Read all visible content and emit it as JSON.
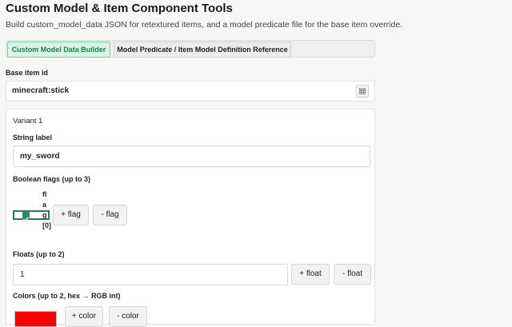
{
  "page": {
    "title": "Custom Model & Item Component Tools",
    "subtitle": "Build custom_model_data JSON for retextured items, and a model predicate file for the base item override."
  },
  "tabs": [
    {
      "label": "Custom Model Data Builder",
      "active": true
    },
    {
      "label": "Model Predicate / Item Model Definition Reference",
      "active": false
    }
  ],
  "base_item": {
    "label": "Base item id",
    "value": "minecraft:stick",
    "picker_icon": "calendar-icon"
  },
  "variant": {
    "title": "Variant 1",
    "string_label": {
      "label": "String label",
      "value": "my_sword"
    },
    "flags": {
      "label": "Boolean flags (up to 3)",
      "items": [
        {
          "name": "flag[0]",
          "checked": true
        }
      ],
      "add_label": "+ flag",
      "remove_label": "- flag"
    },
    "floats": {
      "label": "Floats (up to 2)",
      "values": [
        "1"
      ],
      "add_label": "+ float",
      "remove_label": "- float"
    },
    "colors": {
      "label": "Colors (up to 2, hex → RGB int)",
      "values": [
        "#ff0000"
      ],
      "add_label": "+ color",
      "remove_label": "- color"
    }
  },
  "colors": {
    "accent": "#2c8a63",
    "active_tab_bg": "#d8f4e6",
    "swatch": "#ff0000"
  }
}
